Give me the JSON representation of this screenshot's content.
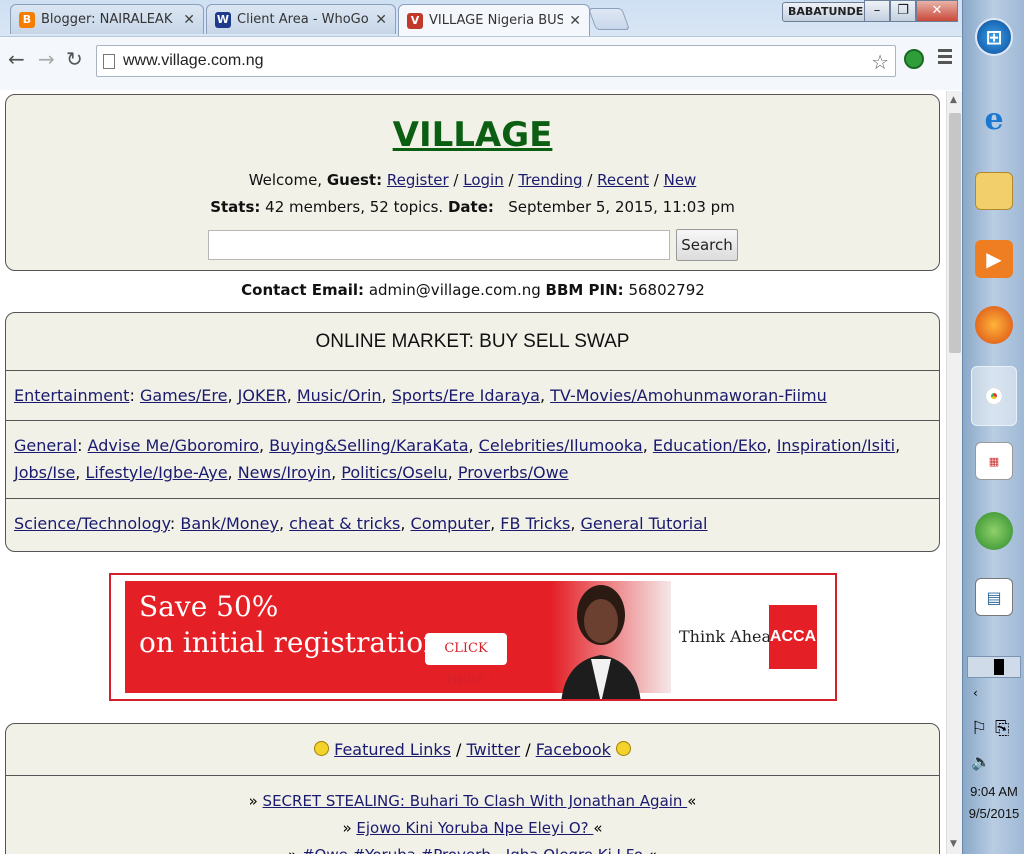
{
  "browser": {
    "tabs": [
      {
        "label": "Blogger: NAIRALEAK - All",
        "icon": "blogger-icon"
      },
      {
        "label": "Client Area - WhoGoHost",
        "icon": "whogohost-icon"
      },
      {
        "label": "VILLAGE Nigeria BUSINES",
        "icon": "village-favicon"
      }
    ],
    "user": "BABATUNDE",
    "url": "www.village.com.ng"
  },
  "header": {
    "logo": "VILLAGE",
    "welcome_prefix": "Welcome, ",
    "guest": "Guest:",
    "links": [
      "Register",
      "Login",
      "Trending",
      "Recent",
      "New"
    ],
    "stats_label": "Stats:",
    "stats_value": "42 members, 52 topics.",
    "date_label": "Date:",
    "date_value": "September 5, 2015, 11:03 pm",
    "search_button": "Search",
    "search_value": ""
  },
  "contact": {
    "email_label": "Contact Email:",
    "email": "admin@village.com.ng",
    "bbm_label": "BBM PIN:",
    "bbm": "56802792"
  },
  "market": {
    "title": "ONLINE MARKET: BUY SELL SWAP",
    "rows": [
      {
        "category": "Entertainment",
        "items": [
          "Games/Ere",
          "JOKER",
          "Music/Orin",
          "Sports/Ere Idaraya",
          "TV-Movies/Amohunmaworan-Fiimu"
        ]
      },
      {
        "category": "General",
        "items": [
          "Advise Me/Gboromiro",
          "Buying&Selling/KaraKata",
          "Celebrities/Ilumooka",
          "Education/Eko",
          "Inspiration/Isiti",
          "Jobs/Ise",
          "Lifestyle/Igbe-Aye",
          "News/Iroyin",
          "Politics/Oselu",
          "Proverbs/Owe"
        ]
      },
      {
        "category": "Science/Technology",
        "items": [
          "Bank/Money",
          "cheat & tricks",
          "Computer",
          "FB Tricks",
          "General Tutorial"
        ]
      }
    ]
  },
  "ad": {
    "headline_1": "Save 50%",
    "headline_2": "on initial registration.",
    "cta": "CLICK HERE",
    "tagline": "Think Ahead",
    "logo": "ACCA",
    "color": "#e41f26"
  },
  "featured": {
    "links": [
      "Featured Links",
      "Twitter",
      "Facebook"
    ],
    "items": [
      " SECRET STEALING: Buhari To Clash With Jonathan Again ",
      " Ejowo Kini Yoruba Npe Eleyi O? ",
      " #Owe #Yoruba #Proverb - Igba Olegre Ki I Fo "
    ]
  },
  "taskbar": {
    "time": "9:04 AM",
    "date": "9/5/2015"
  }
}
